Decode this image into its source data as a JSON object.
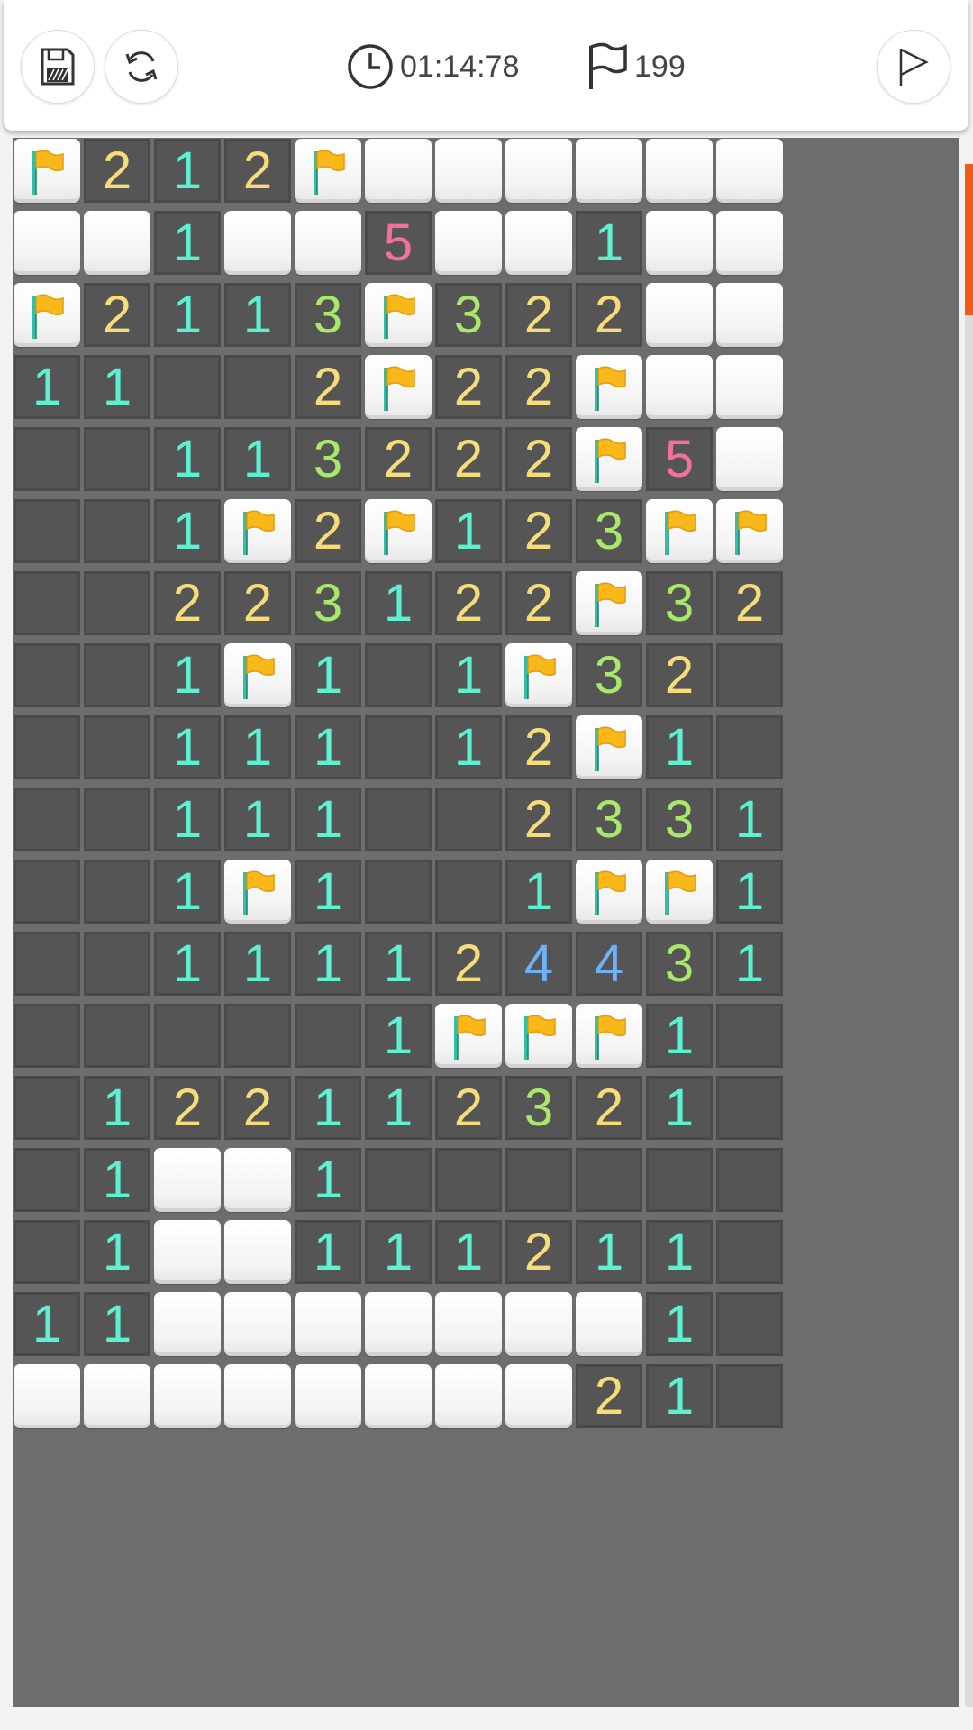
{
  "header": {
    "save_icon": "floppy-disk-icon",
    "restart_icon": "refresh-arrows-icon",
    "timer_icon": "clock-icon",
    "timer": "01:14:78",
    "flag_icon": "flag-icon",
    "flags_remaining": "199",
    "flag_mode_icon": "flag-outline-icon"
  },
  "colors": {
    "open_cell": "#555555",
    "closed_cell": "#ffffff",
    "grid": "#6d6d6d",
    "accent": "#f05a12",
    "n1": "#5df0d2",
    "n2": "#f7dd7a",
    "n3": "#a9e86a",
    "n4": "#6fb1f6",
    "n5": "#f2709a",
    "flag": "#f9b81a"
  },
  "legend": {
    "F": "flag",
    "C": "covered",
    "0": "empty",
    "1-8": "number"
  },
  "board": {
    "columns": 11,
    "rows_visible": 18,
    "rows": [
      [
        "F",
        "2",
        "1",
        "2",
        "F",
        "C",
        "C",
        "C",
        "C",
        "C",
        "C"
      ],
      [
        "C",
        "C",
        "1",
        "C",
        "C",
        "5",
        "C",
        "C",
        "1",
        "C",
        "C"
      ],
      [
        "F",
        "2",
        "1",
        "1",
        "3",
        "F",
        "3",
        "2",
        "2",
        "C",
        "C"
      ],
      [
        "1",
        "1",
        "0",
        "0",
        "2",
        "F",
        "2",
        "2",
        "F",
        "C",
        "C"
      ],
      [
        "0",
        "0",
        "1",
        "1",
        "3",
        "2",
        "2",
        "2",
        "F",
        "5",
        "C"
      ],
      [
        "0",
        "0",
        "1",
        "F",
        "2",
        "F",
        "1",
        "2",
        "3",
        "F",
        "F"
      ],
      [
        "0",
        "0",
        "2",
        "2",
        "3",
        "1",
        "2",
        "2",
        "F",
        "3",
        "2"
      ],
      [
        "0",
        "0",
        "1",
        "F",
        "1",
        "0",
        "1",
        "F",
        "3",
        "2",
        "0"
      ],
      [
        "0",
        "0",
        "1",
        "1",
        "1",
        "0",
        "1",
        "2",
        "F",
        "1",
        "0"
      ],
      [
        "0",
        "0",
        "1",
        "1",
        "1",
        "0",
        "0",
        "2",
        "3",
        "3",
        "1"
      ],
      [
        "0",
        "0",
        "1",
        "F",
        "1",
        "0",
        "0",
        "1",
        "F",
        "F",
        "1"
      ],
      [
        "0",
        "0",
        "1",
        "1",
        "1",
        "1",
        "2",
        "4",
        "4",
        "3",
        "1"
      ],
      [
        "0",
        "0",
        "0",
        "0",
        "0",
        "1",
        "F",
        "F",
        "F",
        "1",
        "0"
      ],
      [
        "0",
        "1",
        "2",
        "2",
        "1",
        "1",
        "2",
        "3",
        "2",
        "1",
        "0"
      ],
      [
        "0",
        "1",
        "C",
        "C",
        "1",
        "0",
        "0",
        "0",
        "0",
        "0",
        "0"
      ],
      [
        "0",
        "1",
        "C",
        "C",
        "1",
        "1",
        "1",
        "2",
        "1",
        "1",
        "0"
      ],
      [
        "1",
        "1",
        "C",
        "C",
        "C",
        "C",
        "C",
        "C",
        "C",
        "1",
        "0"
      ],
      [
        "C",
        "C",
        "C",
        "C",
        "C",
        "C",
        "C",
        "C",
        "2",
        "1",
        "0"
      ]
    ]
  }
}
